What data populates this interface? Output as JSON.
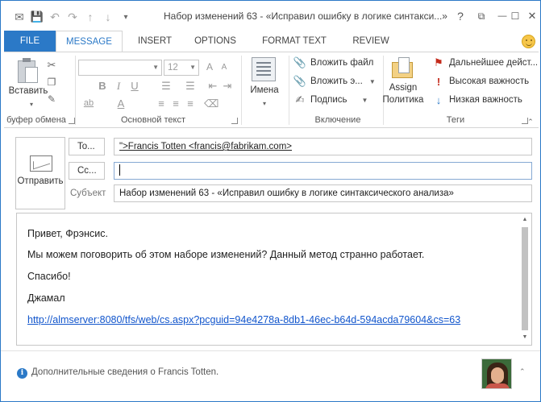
{
  "window": {
    "title": "Набор изменений 63 - «Исправил ошибку в логике синтакси...»",
    "help": "?",
    "restore": "⧉",
    "minimize": "—",
    "maximize": "☐",
    "close": "✕"
  },
  "qat": {
    "mail_icon": "✉",
    "save_icon": "💾",
    "undo_icon": "↶",
    "redo_icon": "↷",
    "up_icon": "↑",
    "down_icon": "↓",
    "customize_icon": "▾"
  },
  "tabs": [
    "FILE",
    "MESSAGE",
    "INSERT",
    "OPTIONS",
    "FORMAT TEXT",
    "REVIEW"
  ],
  "ribbon": {
    "clipboard": {
      "paste_label": "Вставить",
      "group_label": "буфер обмена"
    },
    "basic_text": {
      "font_name": "",
      "font_size": "12",
      "bold": "B",
      "italic": "I",
      "underline": "U",
      "highlight": "ab",
      "font_color": "A",
      "grow_font": "A",
      "shrink_font": "A",
      "group_label": "Основной текст"
    },
    "names": {
      "label": "Имена"
    },
    "include": {
      "attach_file": "Вложить файл",
      "attach_item": "Вложить э...",
      "signature": "Подпись",
      "group_label": "Включение"
    },
    "tags": {
      "assign_policy_line1": "Assign",
      "assign_policy_line2": "Политика",
      "follow_up": "Дальнейшее дейст...",
      "high_importance": "Высокая важность",
      "low_importance": "Низкая важность",
      "group_label": "Теги"
    }
  },
  "compose": {
    "send_label": "Отправить",
    "to_label": "To...",
    "cc_label": "Cc...",
    "subject_label": "Субъект",
    "to_value": "\">Francis Totten <francis@fabrikam.com>",
    "cc_value": "",
    "subject_value": "Набор изменений 63 - «Исправил ошибку в логике синтаксического анализа»"
  },
  "body": {
    "greeting": "Привет, Фрэнсис.",
    "line1": "Мы можем поговорить об этом наборе изменений? Данный метод странно работает.",
    "thanks": "Спасибо!",
    "signature": "Джамал",
    "link": "http://almserver:8080/tfs/web/cs.aspx?pcguid=94e4278a-8db1-46ec-b64d-594acda79604&cs=63"
  },
  "people_pane": {
    "text": "Дополнительные сведения о Francis Totten."
  },
  "colors": {
    "accent": "#2b79c7",
    "link": "#1155cc",
    "high_importance": "#c42b1c"
  }
}
